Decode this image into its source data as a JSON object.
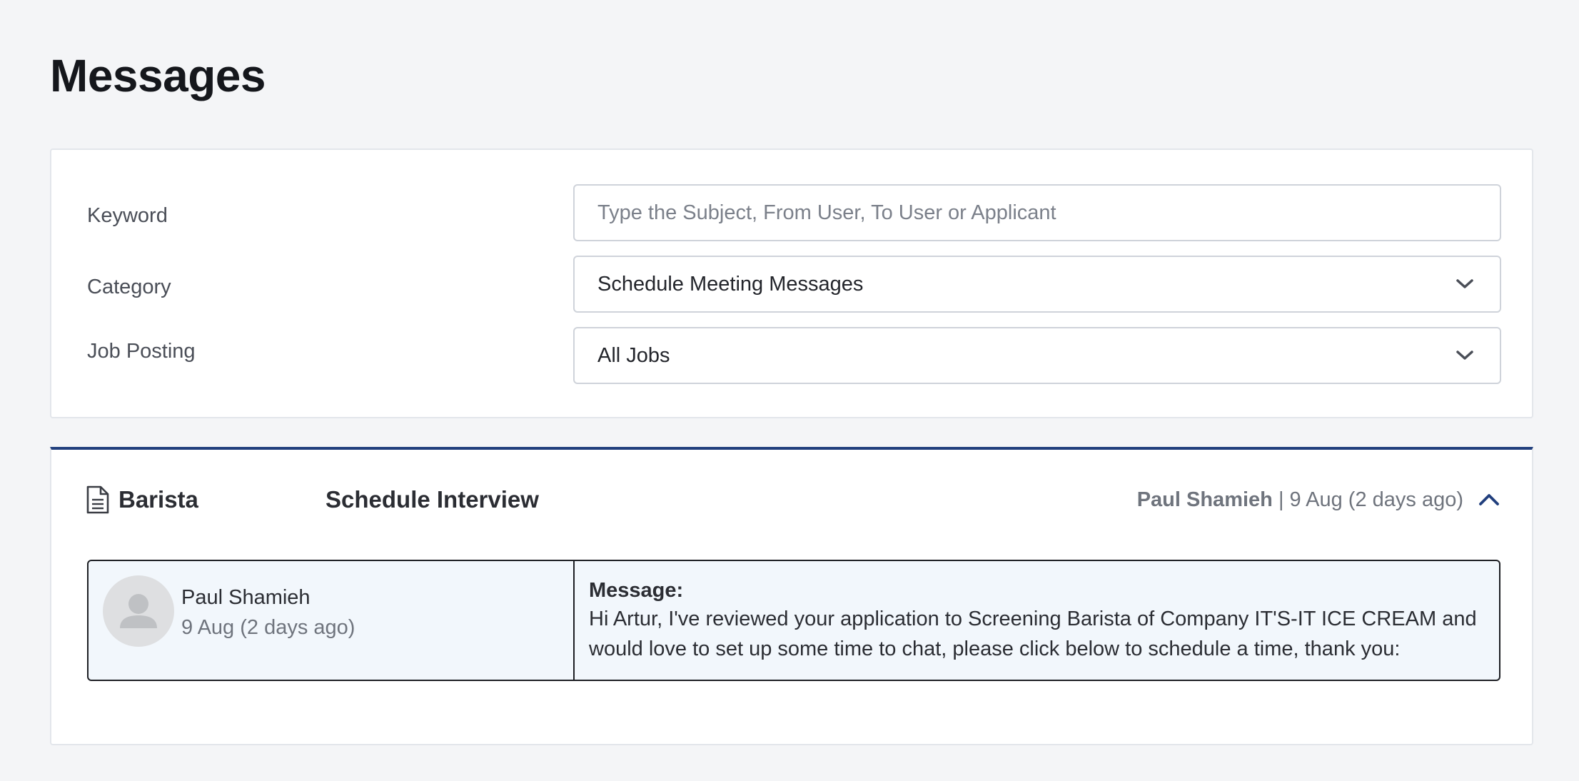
{
  "page": {
    "title": "Messages"
  },
  "filters": {
    "keyword": {
      "label": "Keyword",
      "value": "",
      "placeholder": "Type the Subject, From User, To User or Applicant"
    },
    "category": {
      "label": "Category",
      "selected": "Schedule Meeting Messages"
    },
    "job_posting": {
      "label": "Job Posting",
      "selected": "All Jobs"
    }
  },
  "message_thread": {
    "job_icon": "document-icon",
    "job_title": "Barista",
    "category": "Schedule Interview",
    "sender": "Paul Shamieh",
    "separator": "|",
    "date": "9 Aug (2 days ago)",
    "toggle_icon": "chevron-up-icon",
    "accent_color": "#213f7d",
    "messages": [
      {
        "avatar_icon": "user-avatar-placeholder",
        "sender_name": "Paul Shamieh",
        "date": "9 Aug (2 days ago)",
        "label": "Message:",
        "body": "Hi Artur, I've reviewed your application to Screening Barista of Company IT'S-IT ICE CREAM and would love to set up some time to chat, please click below to schedule a time, thank you:"
      }
    ]
  }
}
